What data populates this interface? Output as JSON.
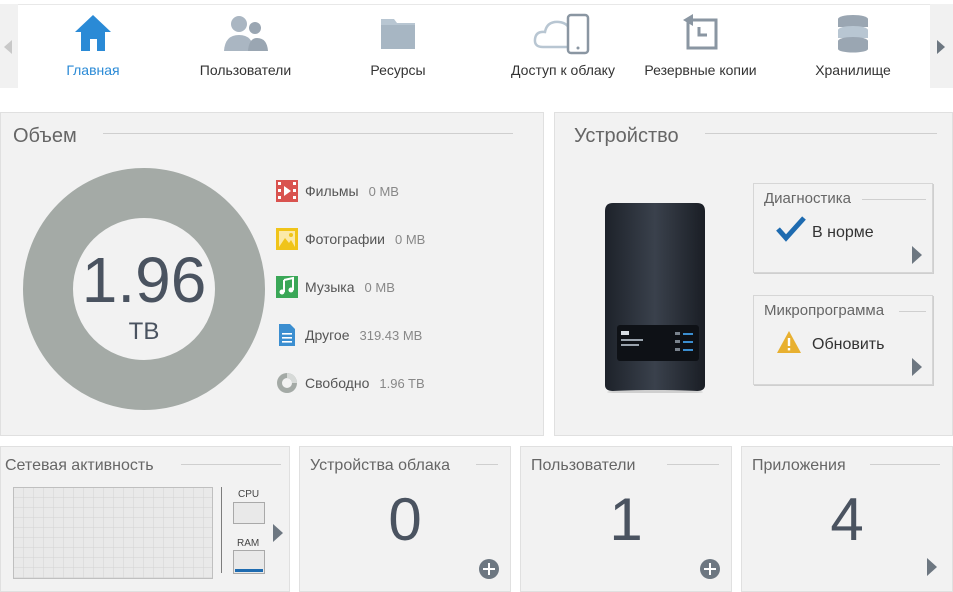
{
  "nav": {
    "items": [
      {
        "label": "Главная",
        "icon": "home-icon",
        "active": true
      },
      {
        "label": "Пользователи",
        "icon": "users-icon"
      },
      {
        "label": "Ресурсы",
        "icon": "folder-icon"
      },
      {
        "label": "Доступ к облаку",
        "icon": "cloud-access-icon"
      },
      {
        "label": "Резервные копии",
        "icon": "backup-icon"
      },
      {
        "label": "Хранилище",
        "icon": "storage-icon"
      }
    ],
    "active_color": "#2a8ad6"
  },
  "capacity": {
    "title": "Объем",
    "total_value": "1.96",
    "total_unit": "TB",
    "legend": [
      {
        "label": "Фильмы",
        "value": "0 MB",
        "icon": "film-icon",
        "color": "#d9534f"
      },
      {
        "label": "Фотографии",
        "value": "0 MB",
        "icon": "photo-icon",
        "color": "#f0c419"
      },
      {
        "label": "Музыка",
        "value": "0 MB",
        "icon": "music-icon",
        "color": "#3aa757"
      },
      {
        "label": "Другое",
        "value": "319.43 MB",
        "icon": "document-icon",
        "color": "#3b8ed0"
      },
      {
        "label": "Свободно",
        "value": "1.96 TB",
        "icon": "free-space-icon",
        "color": "#a4aaa6"
      }
    ]
  },
  "device": {
    "title": "Устройство",
    "diagnostics": {
      "title": "Диагностика",
      "status": "В норме",
      "icon": "checkmark-icon"
    },
    "firmware": {
      "title": "Микропрограмма",
      "status": "Обновить",
      "icon": "warning-icon"
    }
  },
  "network": {
    "title": "Сетевая активность",
    "cpu_label": "CPU",
    "ram_label": "RAM"
  },
  "cloud_devices": {
    "title": "Устройства облака",
    "count": "0"
  },
  "users": {
    "title": "Пользователи",
    "count": "1"
  },
  "apps": {
    "title": "Приложения",
    "count": "4"
  }
}
